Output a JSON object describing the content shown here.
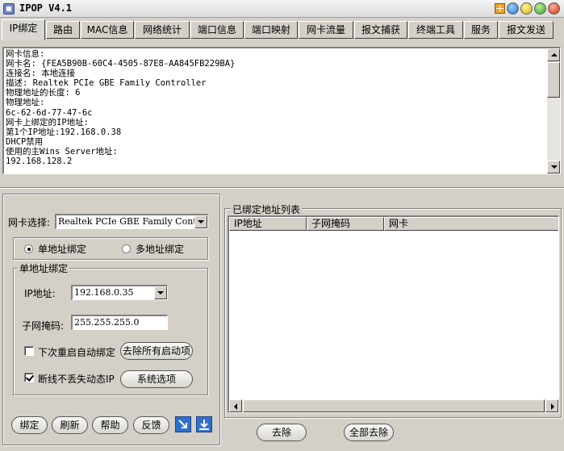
{
  "window": {
    "title": "IPOP V4.1"
  },
  "tabs": [
    {
      "label": "IP绑定",
      "active": true
    },
    {
      "label": "路由"
    },
    {
      "label": "MAC信息"
    },
    {
      "label": "网络统计"
    },
    {
      "label": "端口信息"
    },
    {
      "label": "端口映射"
    },
    {
      "label": "网卡流量"
    },
    {
      "label": "报文捕获"
    },
    {
      "label": "终端工具"
    },
    {
      "label": "服务"
    },
    {
      "label": "报文发送"
    }
  ],
  "info_text": {
    "lines": [
      "网卡信息:",
      "网卡名: {FEA5B90B-60C4-4505-87E8-AA845FB229BA}",
      "连接名: 本地连接",
      "描述: Realtek PCIe GBE Family Controller",
      "物理地址的长度: 6",
      "物理地址:",
      "6c-62-6d-77-47-6c",
      "网卡上绑定的IP地址:",
      "第1个IP地址:192.168.0.38",
      "DHCP禁用",
      "使用的主Wins Server地址:",
      "192.168.128.2"
    ]
  },
  "left_panel": {
    "nic_label": "网卡选择:",
    "nic_value": "Realtek PCIe GBE Family Controller",
    "mode": {
      "single_label": "单地址绑定",
      "multi_label": "多地址绑定",
      "selected": "single"
    },
    "single_group": {
      "legend": "单地址绑定",
      "ip_label": "IP地址:",
      "ip_value": "192.168.0.35",
      "mask_label": "子网掩码:",
      "mask_value": "255.255.255.0",
      "auto_bind_label": "下次重启自动绑定",
      "auto_bind_checked": false,
      "remove_startup_label": "去除所有启动项",
      "keep_dynamic_label": "断线不丢失动态IP",
      "keep_dynamic_checked": true,
      "system_options_label": "系统选项"
    },
    "actions": {
      "bind": "绑定",
      "refresh": "刷新",
      "help": "帮助",
      "feedback": "反馈"
    },
    "icons": {
      "arrow": "arrow-down-right-icon",
      "download": "download-icon"
    }
  },
  "right_panel": {
    "legend": "已绑定地址列表",
    "columns": [
      "IP地址",
      "子网掩码",
      "网卡"
    ],
    "rows": [],
    "remove_label": "去除",
    "remove_all_label": "全部去除"
  },
  "colors": {
    "face": "#d4d0c8",
    "icon_blue": "#2f6fd0"
  }
}
